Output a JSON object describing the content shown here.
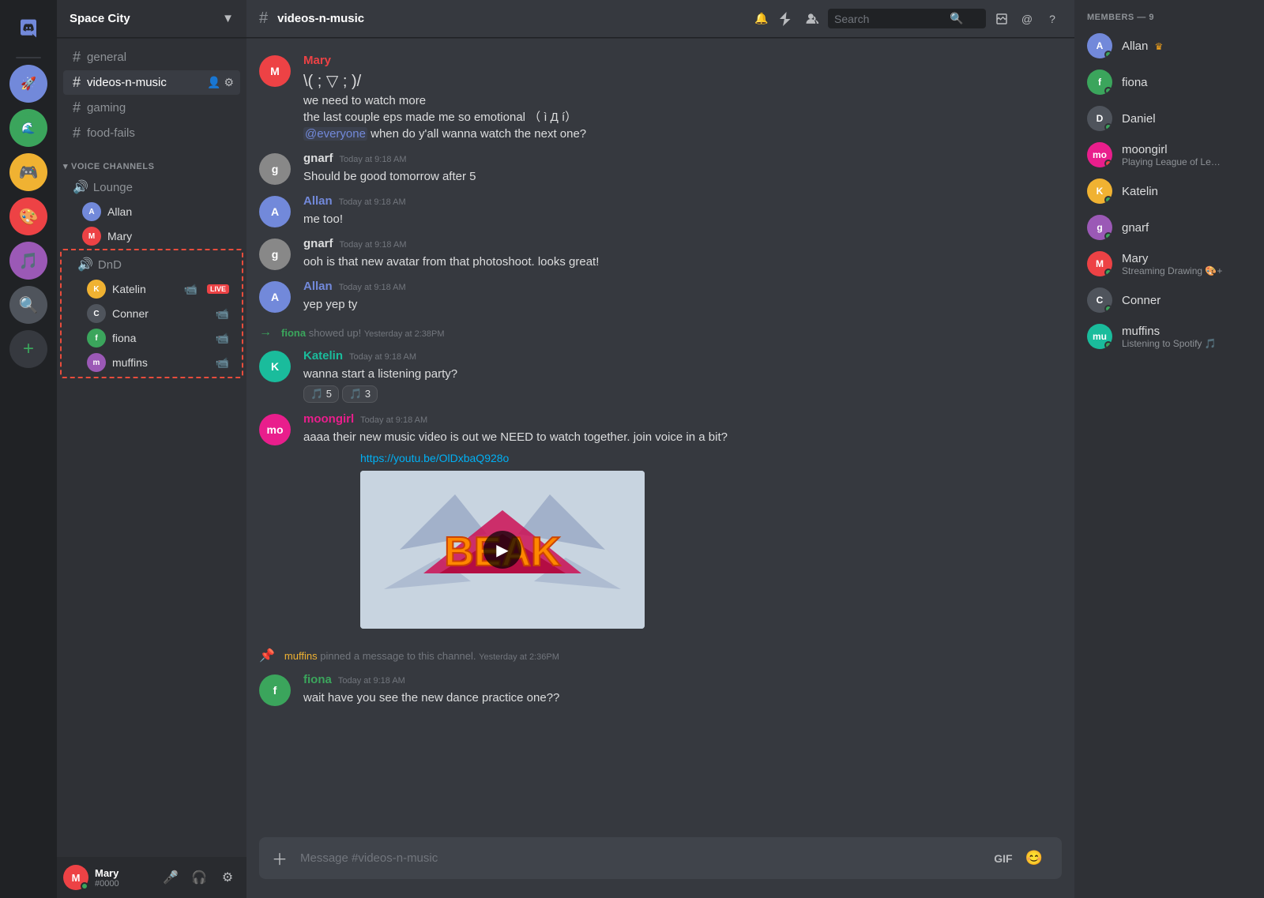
{
  "app": {
    "title": "Discord"
  },
  "servers": [
    {
      "id": "discord",
      "label": "Discord",
      "icon": "discord",
      "color": "#7289da"
    },
    {
      "id": "s1",
      "label": "Space",
      "icon": "🚀",
      "color": "#3ba55c"
    },
    {
      "id": "s2",
      "label": "Game",
      "icon": "🎮",
      "color": "#f0b232"
    },
    {
      "id": "s3",
      "label": "Art",
      "icon": "🎨",
      "color": "#ed4245"
    },
    {
      "id": "s4",
      "label": "Music",
      "icon": "🎵",
      "color": "#9b59b6"
    },
    {
      "id": "s5",
      "label": "Search",
      "icon": "🔍",
      "color": "#4f545c"
    },
    {
      "id": "s6",
      "label": "Add",
      "icon": "+",
      "color": "#3ba55c"
    }
  ],
  "sidebar": {
    "server_name": "Space City",
    "channels": [
      {
        "name": "general",
        "type": "text",
        "active": false
      },
      {
        "name": "videos-n-music",
        "type": "text",
        "active": true
      },
      {
        "name": "gaming",
        "type": "text",
        "active": false
      },
      {
        "name": "food-fails",
        "type": "text",
        "active": false
      }
    ],
    "voice_category": "VOICE CHANNELS",
    "voice_channels": [
      {
        "name": "Lounge",
        "members": [
          {
            "name": "Allan",
            "avatar_color": "#7289da",
            "initials": "A"
          },
          {
            "name": "Mary",
            "avatar_color": "#ed4245",
            "initials": "M"
          }
        ]
      },
      {
        "name": "DnD",
        "members": [
          {
            "name": "Katelin",
            "avatar_color": "#f0b232",
            "initials": "K",
            "live": true,
            "camera": true
          },
          {
            "name": "Conner",
            "avatar_color": "#4f545c",
            "initials": "C",
            "camera": true
          },
          {
            "name": "fiona",
            "avatar_color": "#3ba55c",
            "initials": "f",
            "camera": true
          },
          {
            "name": "muffins",
            "avatar_color": "#9b59b6",
            "initials": "m",
            "camera": true
          }
        ]
      }
    ]
  },
  "current_user": {
    "name": "Mary",
    "tag": "#0000",
    "status": "online",
    "avatar_color": "#ed4245",
    "initials": "M"
  },
  "chat": {
    "channel_name": "videos-n-music",
    "messages": [
      {
        "id": 1,
        "author": "Mary",
        "author_color": "#ed4245",
        "initials": "M",
        "time": "",
        "lines": [
          "\\( ; ▽ ; )/",
          "we need to watch more",
          "the last couple eps made me so emotional （ ì Д í）",
          "@everyone when do y'all wanna watch the next one?"
        ],
        "has_mention": true
      },
      {
        "id": 2,
        "author": "gnarf",
        "author_color": "#4f545c",
        "initials": "g",
        "time": "Today at 9:18 AM",
        "lines": [
          "Should be good tomorrow after 5"
        ]
      },
      {
        "id": 3,
        "author": "Allan",
        "author_color": "#7289da",
        "initials": "A",
        "time": "Today at 9:18 AM",
        "lines": [
          "me too!"
        ]
      },
      {
        "id": 4,
        "author": "gnarf",
        "author_color": "#4f545c",
        "initials": "g",
        "time": "Today at 9:18 AM",
        "lines": [
          "ooh is that new avatar from that photoshoot. looks great!"
        ]
      },
      {
        "id": 5,
        "author": "Allan",
        "author_color": "#7289da",
        "initials": "A",
        "time": "Today at 9:18 AM",
        "lines": [
          "yep yep ty"
        ]
      },
      {
        "id": 6,
        "author": "fiona",
        "author_color": "#3ba55c",
        "initials": "f",
        "time": "Yesterday at 2:38PM",
        "joined": true,
        "lines": []
      },
      {
        "id": 7,
        "author": "Katelin",
        "author_color": "#1abc9c",
        "initials": "K",
        "time": "Today at 9:18 AM",
        "lines": [
          "wanna start a listening party?"
        ],
        "reactions": [
          "🎵 5",
          "🎵 3"
        ]
      },
      {
        "id": 8,
        "author": "moongirl",
        "author_color": "#e91e8c",
        "initials": "mo",
        "time": "Today at 9:18 AM",
        "lines": [
          "aaaa their new music video is out we NEED to watch together. join voice in a bit?"
        ],
        "link": "https://youtu.be/OlDxbaQ928o",
        "has_video": true
      },
      {
        "id": 9,
        "system": true,
        "author": "muffins",
        "text": "muffins pinned a message to this channel.",
        "time": "Yesterday at 2:36PM"
      },
      {
        "id": 10,
        "author": "fiona",
        "author_color": "#3ba55c",
        "initials": "f",
        "time": "Today at 9:18 AM",
        "lines": [
          "wait have you see the new dance practice one??"
        ]
      }
    ],
    "input_placeholder": "Message #videos-n-music"
  },
  "members": {
    "header": "MEMBERS — 9",
    "list": [
      {
        "name": "Allan",
        "avatar_color": "#7289da",
        "initials": "A",
        "is_owner": true,
        "status": "online"
      },
      {
        "name": "fiona",
        "avatar_color": "#3ba55c",
        "initials": "f",
        "status": "online"
      },
      {
        "name": "Daniel",
        "avatar_color": "#4f545c",
        "initials": "D",
        "status": "online"
      },
      {
        "name": "moongirl",
        "avatar_color": "#e91e8c",
        "initials": "mo",
        "status": "dnd",
        "activity": "Playing League of Legends"
      },
      {
        "name": "Katelin",
        "avatar_color": "#f0b232",
        "initials": "K",
        "status": "online"
      },
      {
        "name": "gnarf",
        "avatar_color": "#9b59b6",
        "initials": "g",
        "status": "online"
      },
      {
        "name": "Mary",
        "avatar_color": "#ed4245",
        "initials": "M",
        "status": "online",
        "activity": "Streaming Drawing 🎨+"
      },
      {
        "name": "Conner",
        "avatar_color": "#4f545c",
        "initials": "C",
        "status": "online"
      },
      {
        "name": "muffins",
        "avatar_color": "#1abc9c",
        "initials": "mu",
        "status": "online",
        "activity": "Listening to Spotify 🎵"
      }
    ]
  },
  "header_icons": {
    "bell": "🔔",
    "boost": "🚀",
    "members": "👥",
    "search_placeholder": "Search",
    "download": "⬇",
    "at": "@",
    "help": "?"
  }
}
